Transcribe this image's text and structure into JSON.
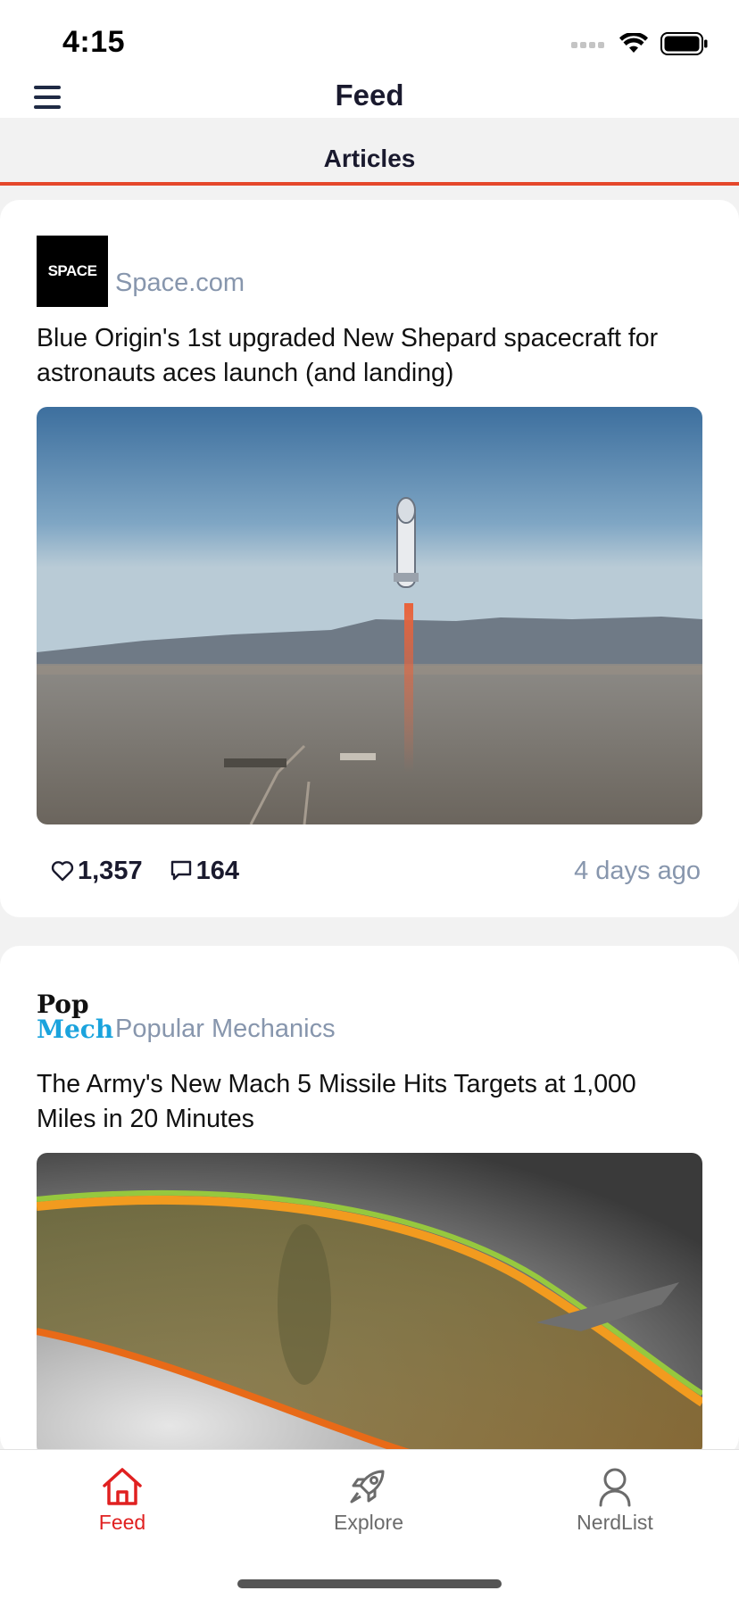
{
  "status": {
    "time": "4:15"
  },
  "header": {
    "title": "Feed"
  },
  "tabs": {
    "active_label": "Articles"
  },
  "articles": [
    {
      "source_name": "Space.com",
      "logo_text": "SPACE",
      "title": "Blue Origin's 1st upgraded New Shepard spacecraft for astronauts aces launch (and landing)",
      "likes": "1,357",
      "comments": "164",
      "time_ago": "4 days ago"
    },
    {
      "source_name": "Popular Mechanics",
      "logo_line1": "Pop",
      "logo_line2": "Mech",
      "title": "The Army's New Mach 5 Missile Hits Targets at 1,000 Miles in 20 Minutes"
    }
  ],
  "nav": {
    "feed": "Feed",
    "explore": "Explore",
    "nerdlist": "NerdList"
  },
  "colors": {
    "accent": "#e5472b",
    "active_nav": "#e02020",
    "inactive_nav": "#6b6b6b",
    "muted_text": "#8796ad"
  },
  "icons": [
    "hamburger-menu-icon",
    "heart-icon",
    "comment-icon",
    "home-icon",
    "rocket-icon",
    "person-icon",
    "wifi-icon",
    "battery-icon",
    "signal-icon"
  ]
}
